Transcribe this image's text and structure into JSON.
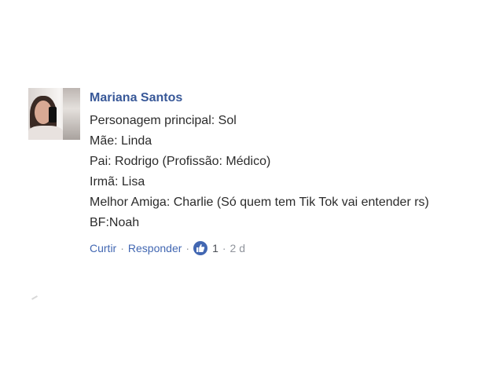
{
  "comment": {
    "author": "Mariana Santos",
    "lines": [
      "Personagem principal: Sol",
      "Mãe: Linda",
      "Pai: Rodrigo (Profissão: Médico)",
      "Irmã: Lisa",
      "Melhor Amiga: Charlie (Só quem tem Tik Tok vai entender rs)",
      "BF:Noah"
    ],
    "actions": {
      "like_label": "Curtir",
      "reply_label": "Responder",
      "separator": "·",
      "reaction_count": "1",
      "timestamp": "2 d"
    }
  },
  "colors": {
    "author": "#385898",
    "action_link": "#4267b2",
    "like_badge": "#4267b2",
    "muted": "#90949c"
  },
  "icons": {
    "reaction": "thumbs-up-icon"
  }
}
